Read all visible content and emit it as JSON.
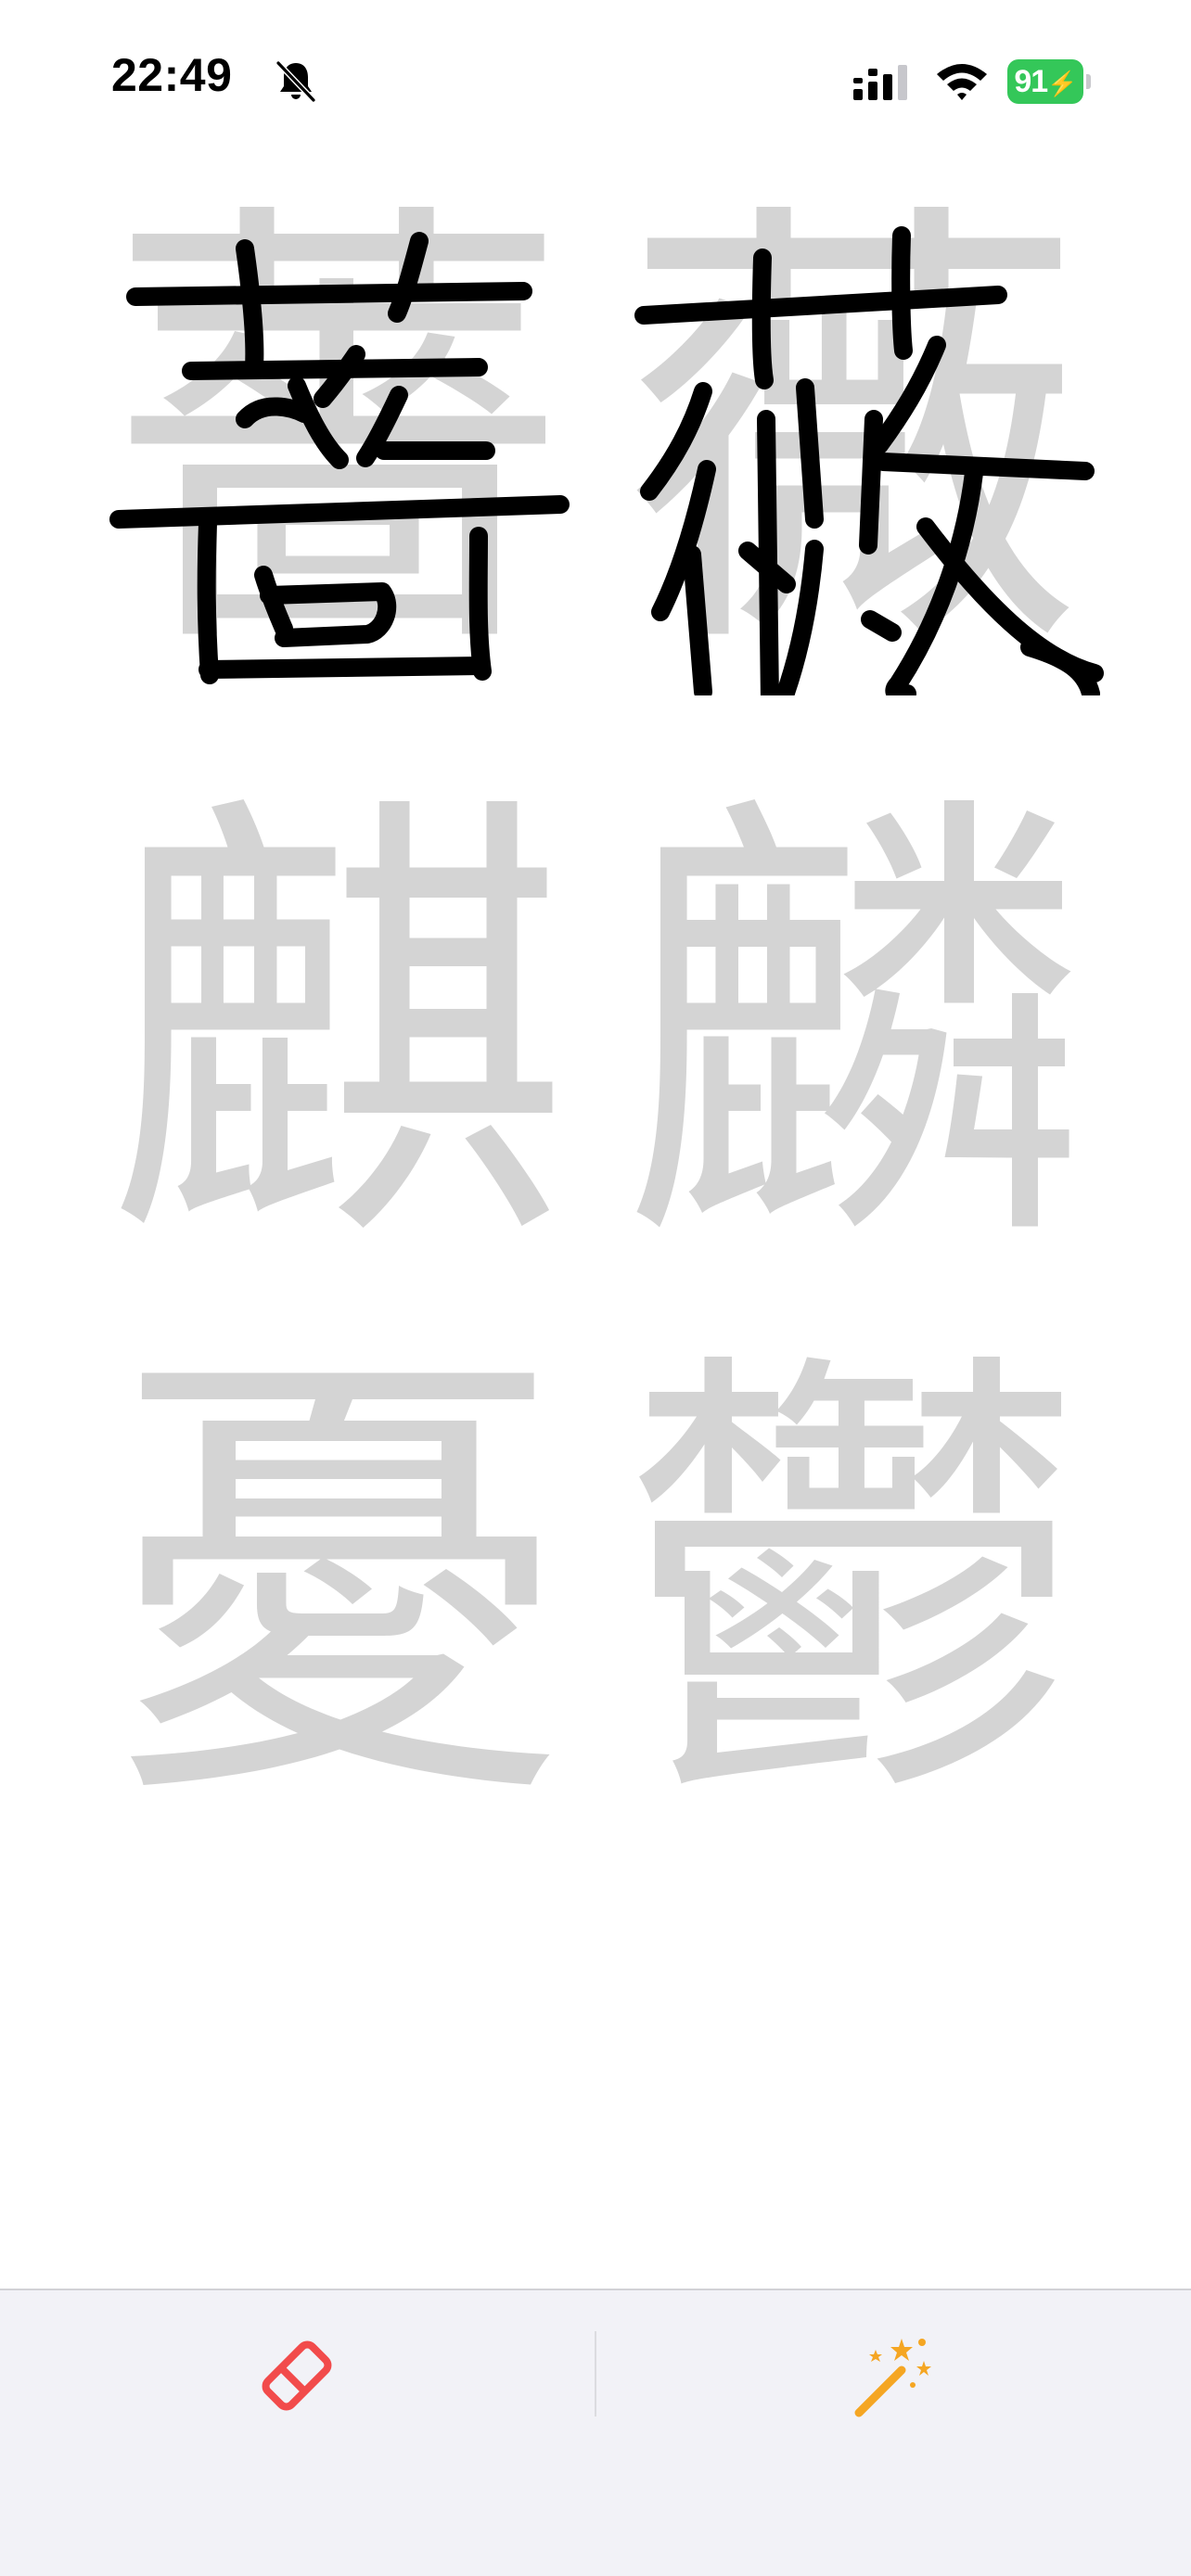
{
  "status_bar": {
    "time": "22:49",
    "battery_level": "91",
    "battery_charging": true,
    "silent_mode": true,
    "icons": [
      "bell-slash-icon",
      "cellular-signal-icon",
      "wifi-icon",
      "battery-icon"
    ]
  },
  "practice": {
    "characters": [
      {
        "char": "薔",
        "traced": true
      },
      {
        "char": "薇",
        "traced": true
      },
      {
        "char": "麒",
        "traced": false
      },
      {
        "char": "麟",
        "traced": false
      },
      {
        "char": "憂",
        "traced": false
      },
      {
        "char": "鬱",
        "traced": false
      }
    ]
  },
  "toolbar": {
    "eraser_icon": "eraser-icon",
    "magic_icon": "magic-wand-icon"
  },
  "colors": {
    "guide_character": "#d4d4d4",
    "stroke": "#000000",
    "toolbar_background": "#f2f2f7",
    "eraser_accent": "#f24b4b",
    "magic_accent": "#f5a623",
    "battery_green": "#34c759"
  }
}
